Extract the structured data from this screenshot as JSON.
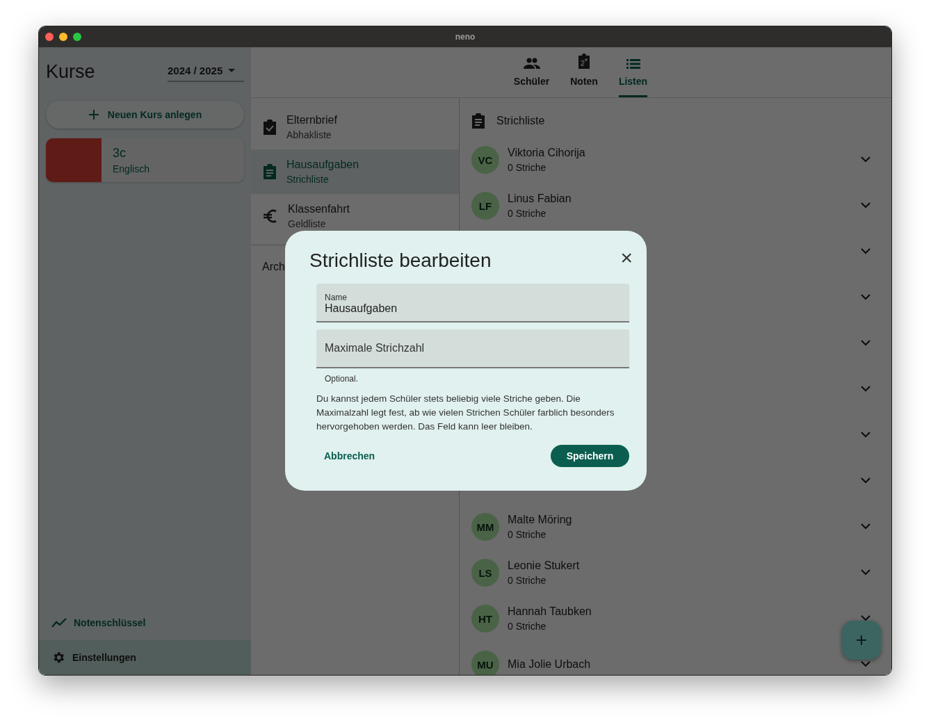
{
  "window": {
    "title": "neno"
  },
  "sidebar": {
    "title": "Kurse",
    "year_selector": "2024 / 2025",
    "new_course_button": "Neuen Kurs anlegen",
    "courses": [
      {
        "name": "3c",
        "subject": "Englisch"
      }
    ],
    "bottom_items": [
      {
        "label": "Notenschlüssel",
        "kind": "chart",
        "selected": false
      },
      {
        "label": "Einstellungen",
        "kind": "gear",
        "selected": true
      }
    ]
  },
  "tabs": [
    {
      "label": "Schüler",
      "kind": "people",
      "selected": false
    },
    {
      "label": "Noten",
      "kind": "grades",
      "selected": false
    },
    {
      "label": "Listen",
      "kind": "list",
      "selected": true
    }
  ],
  "lists": [
    {
      "title": "Elternbrief",
      "type": "Abhakliste",
      "kind": "checklist",
      "selected": false
    },
    {
      "title": "Hausaufgaben",
      "type": "Strichliste",
      "kind": "tally",
      "selected": true
    },
    {
      "title": "Klassenfahrt",
      "type": "Geldliste",
      "kind": "money",
      "selected": false
    }
  ],
  "archive_label": "Arch",
  "detail": {
    "title": "Strichliste",
    "students": [
      {
        "kind": "student",
        "initials": "VC",
        "name": "Viktoria Cihorija",
        "count": "0 Striche"
      },
      {
        "kind": "student",
        "initials": "LF",
        "name": "Linus Fabian",
        "count": "0 Striche"
      },
      {
        "kind": "covered"
      },
      {
        "kind": "covered"
      },
      {
        "kind": "covered"
      },
      {
        "kind": "covered"
      },
      {
        "kind": "covered"
      },
      {
        "kind": "covered"
      },
      {
        "kind": "student",
        "initials": "MM",
        "name": "Malte Möring",
        "count": "0 Striche"
      },
      {
        "kind": "student",
        "initials": "LS",
        "name": "Leonie Stukert",
        "count": "0 Striche"
      },
      {
        "kind": "student",
        "initials": "HT",
        "name": "Hannah Taubken",
        "count": "0 Striche"
      },
      {
        "kind": "student",
        "initials": "MU",
        "name": "Mia Jolie Urbach"
      }
    ]
  },
  "fab": "+",
  "dialog": {
    "title": "Strichliste bearbeiten",
    "close": "×",
    "name_field": {
      "label": "Name",
      "value": "Hausaufgaben"
    },
    "max_field": {
      "placeholder": "Maximale Strichzahl"
    },
    "helper": "Optional.",
    "description": "Du kannst jedem Schüler stets beliebig viele Striche geben. Die Maximalzahl legt fest, ab wie vielen Strichen Schüler farblich besonders hervorgehoben werden. Das Feld kann leer bleiben.",
    "cancel": "Abbrechen",
    "save": "Speichern"
  }
}
